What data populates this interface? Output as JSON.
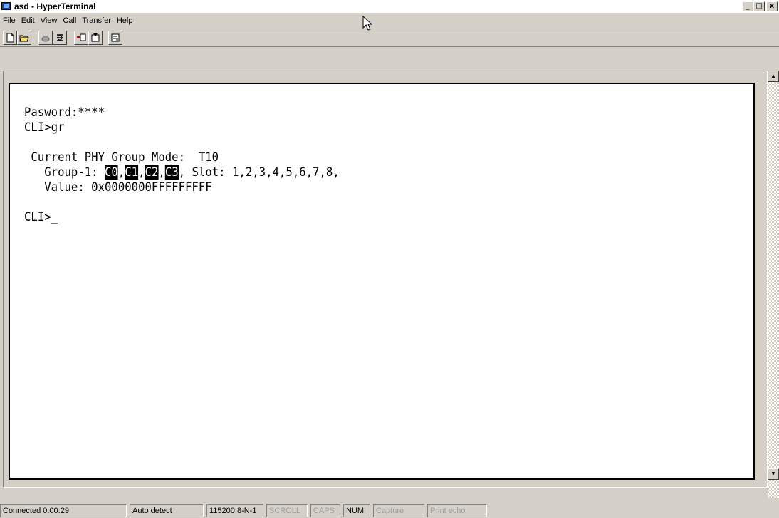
{
  "window": {
    "title": "asd - HyperTerminal",
    "minimize": "_",
    "maximize": "□",
    "close": "x"
  },
  "menu": [
    "File",
    "Edit",
    "View",
    "Call",
    "Transfer",
    "Help"
  ],
  "toolbar": {
    "buttons": [
      "new-icon",
      "open-icon",
      "disconnect-icon",
      "dial-icon",
      "send-icon",
      "receive-icon",
      "properties-icon"
    ]
  },
  "terminal": {
    "line1": "Pasword:****",
    "line2": "CLI>gr",
    "line3": " Current PHY Group Mode:  T10",
    "line4_prefix": "   Group-1: ",
    "line4_c0": "C0",
    "line4_c1": "C1",
    "line4_c2": "C2",
    "line4_c3": "C3",
    "line4_suffix": ", Slot: 1,2,3,4,5,6,7,8,",
    "line5": "   Value: 0x0000000FFFFFFFFF",
    "line6": "CLI>_"
  },
  "status": {
    "connected": "Connected 0:00:29",
    "detect": "Auto detect",
    "baud": "115200 8-N-1",
    "scroll": "SCROLL",
    "caps": "CAPS",
    "num": "NUM",
    "capture": "Capture",
    "print_echo": "Print echo"
  }
}
